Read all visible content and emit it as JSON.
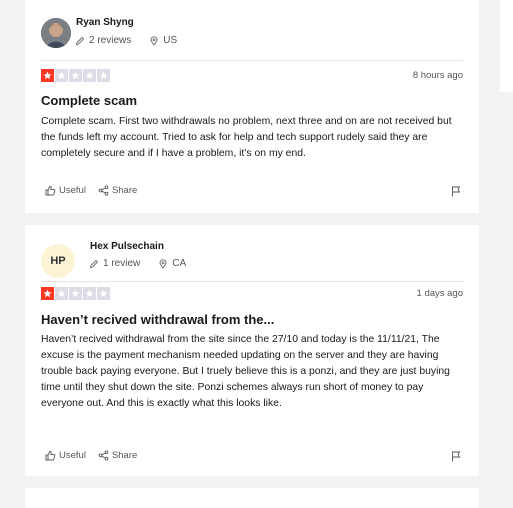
{
  "reviews": [
    {
      "reviewer_name": "Ryan Shyng",
      "review_count": "2 reviews",
      "country": "US",
      "rating": 1,
      "date": "8 hours ago",
      "title": "Complete scam",
      "body": "Complete scam. First two withdrawals no problem, next three and on are not received but the funds left my account. Tried to ask for help and tech support rudely said they are completely secure and if I have a problem, it’s on my end.",
      "useful_label": "Useful",
      "share_label": "Share"
    },
    {
      "reviewer_initials": "HP",
      "reviewer_name": "Hex Pulsechain",
      "review_count": "1 review",
      "country": "CA",
      "rating": 1,
      "date": "1 days ago",
      "title": "Haven’t recived withdrawal from the...",
      "body": "Haven’t recived withdrawal from the site since the 27/10 and today is the 11/11/21, The excuse is the payment mechanism needed updating on the server and they are having trouble back paying everyone. But I truely believe this is a ponzi, and they are just buying time until they shut down the site. Ponzi schemes always run short of money to pay everyone out. And this is exactly what this looks like.",
      "useful_label": "Useful",
      "share_label": "Share"
    }
  ],
  "colors": {
    "star_active": "#ff3722",
    "star_inactive": "#dcdce6",
    "initials_avatar_bg": "#fbf3d3",
    "card_bg": "#ffffff",
    "page_bg": "#f2f2f2"
  }
}
